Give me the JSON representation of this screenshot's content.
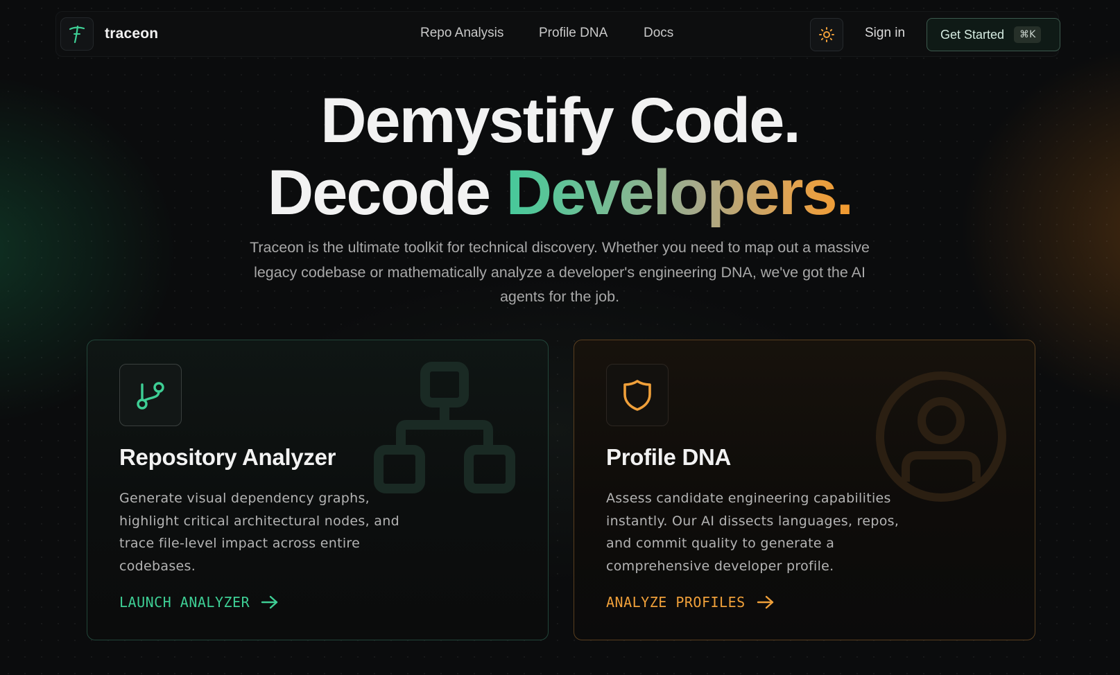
{
  "nav": {
    "brand": "traceon",
    "links": [
      "Repo Analysis",
      "Profile DNA",
      "Docs"
    ],
    "sign_in": "Sign in",
    "cta": "Get Started",
    "shortcut": "⌘K"
  },
  "hero": {
    "line1": "Demystify Code.",
    "line2_plain": "Decode",
    "line2_gradient": "Developers.",
    "subtitle": "Traceon is the ultimate toolkit for technical discovery. Whether you need to map out a massive legacy codebase or mathematically analyze a developer's engineering DNA, we've got the AI agents for the job."
  },
  "cards": [
    {
      "title": "Repository Analyzer",
      "description": "Generate visual dependency graphs, highlight critical architectural nodes, and trace file-level impact across entire codebases.",
      "cta": "LAUNCH ANALYZER",
      "icon": "git-branch-icon",
      "accent": "#3ecf95"
    },
    {
      "title": "Profile DNA",
      "description": "Assess candidate engineering capabilities instantly. Our AI dissects languages, repos, and commit quality to generate a comprehensive developer profile.",
      "cta": "ANALYZE PROFILES",
      "icon": "shield-icon",
      "accent": "#f0a03a"
    }
  ],
  "colors": {
    "background": "#0b0c0d",
    "green_accent": "#3ecf95",
    "orange_accent": "#f0a03a",
    "sun_icon": "#f0a03a"
  }
}
